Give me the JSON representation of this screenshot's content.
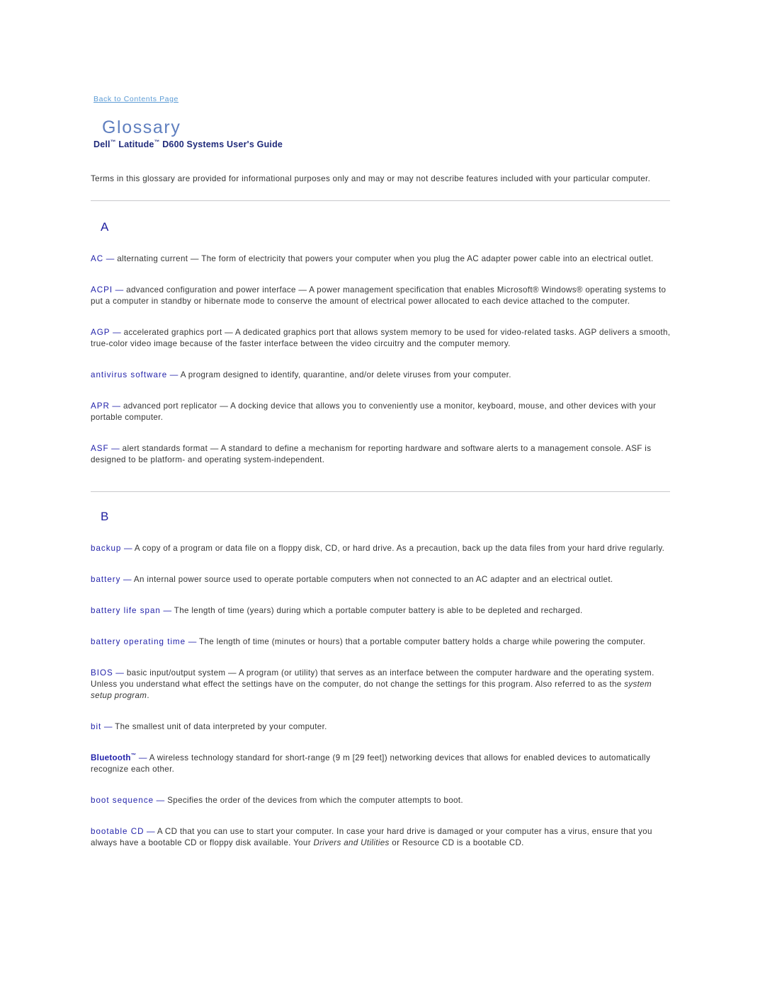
{
  "header": {
    "back_link": "Back to Contents Page",
    "title": "Glossary",
    "subtitle_parts": {
      "dell": "Dell",
      "tm1": "™",
      "latitude": " Latitude",
      "tm2": "™",
      "rest": " D600 Systems User's Guide"
    },
    "subtitle_full": "Dell™ Latitude™ D600 Systems User's Guide"
  },
  "intro": "Terms in this glossary are provided for informational purposes only and may or may not describe features included with your particular computer.",
  "sections": [
    {
      "letter": "A",
      "entries": [
        {
          "term": "AC",
          "dash": "—",
          "definition": "alternating current — The form of electricity that powers your computer when you plug the AC adapter power cable into an electrical outlet."
        },
        {
          "term": "ACPI",
          "dash": "—",
          "definition": "advanced configuration and power interface — A power management specification that enables Microsoft® Windows® operating systems to put a computer in standby or hibernate mode to conserve the amount of electrical power allocated to each device attached to the computer."
        },
        {
          "term": "AGP",
          "dash": "—",
          "definition": "accelerated graphics port — A dedicated graphics port that allows system memory to be used for video-related tasks. AGP delivers a smooth, true-color video image because of the faster interface between the video circuitry and the computer memory."
        },
        {
          "term": "antivirus software",
          "dash": "—",
          "definition": "A program designed to identify, quarantine, and/or delete viruses from your computer."
        },
        {
          "term": "APR",
          "dash": "—",
          "definition": "advanced port replicator — A docking device that allows you to conveniently use a monitor, keyboard, mouse, and other devices with your portable computer."
        },
        {
          "term": "ASF",
          "dash": "—",
          "definition": "alert standards format — A standard to define a mechanism for reporting hardware and software alerts to a management console. ASF is designed to be platform- and operating system-independent."
        }
      ]
    },
    {
      "letter": "B",
      "entries": [
        {
          "term": "backup",
          "dash": "—",
          "definition": "A copy of a program or data file on a floppy disk, CD, or hard drive. As a precaution, back up the data files from your hard drive regularly."
        },
        {
          "term": "battery",
          "dash": "—",
          "definition": "An internal power source used to operate portable computers when not connected to an AC adapter and an electrical outlet."
        },
        {
          "term": "battery life span",
          "dash": "—",
          "definition": "The length of time (years) during which a portable computer battery is able to be depleted and recharged."
        },
        {
          "term": "battery operating time",
          "dash": "—",
          "definition": "The length of time (minutes or hours) that a portable computer battery holds a charge while powering the computer."
        },
        {
          "term": "BIOS",
          "dash": "—",
          "definition_pre": "basic input/output system — A program (or utility) that serves as an interface between the computer hardware and the operating system. Unless you understand what effect the settings have on the computer, do not change the settings for this program. Also referred to as the ",
          "definition_italic": "system setup program",
          "definition_post": "."
        },
        {
          "term": "bit",
          "dash": "—",
          "definition": "The smallest unit of data interpreted by your computer."
        },
        {
          "term": "Bluetooth",
          "term_tm": "™",
          "term_bold": true,
          "dash": "—",
          "definition": "A wireless technology standard for short-range (9 m [29 feet]) networking devices that allows for enabled devices to automatically recognize each other."
        },
        {
          "term": "boot sequence",
          "dash": "—",
          "definition": "Specifies the order of the devices from which the computer attempts to boot."
        },
        {
          "term": "bootable CD",
          "dash": "—",
          "definition_pre": "A CD that you can use to start your computer. In case your hard drive is damaged or your computer has a virus, ensure that you always have a bootable CD or floppy disk available. Your ",
          "definition_italic": "Drivers and Utilities",
          "definition_post": " or Resource CD is a bootable CD."
        }
      ]
    }
  ],
  "colors": {
    "title": "#5f7fbf",
    "subtitle": "#1f2a7a",
    "term": "#2222aa",
    "link": "#5b9bd5",
    "body": "#333333",
    "rule": "#c8c8cc"
  }
}
